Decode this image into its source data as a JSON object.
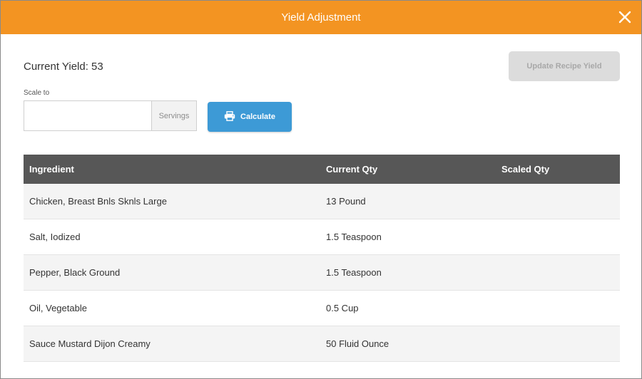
{
  "dialog": {
    "title": "Yield Adjustment",
    "close_icon": "close-icon",
    "header_color": "#f39422"
  },
  "current_yield_label": "Current Yield: 53",
  "update_button_label": "Update Recipe Yield",
  "scale": {
    "label": "Scale to",
    "value": "",
    "placeholder": "",
    "addon": "Servings"
  },
  "calculate_button": {
    "label": "Calculate",
    "icon": "printer-icon",
    "color": "#3d9ad6"
  },
  "table": {
    "headers": [
      "Ingredient",
      "Current Qty",
      "Scaled Qty"
    ],
    "rows": [
      {
        "ingredient": "Chicken, Breast Bnls Sknls Large",
        "current_qty": "13 Pound",
        "scaled_qty": ""
      },
      {
        "ingredient": "Salt, Iodized",
        "current_qty": "1.5 Teaspoon",
        "scaled_qty": ""
      },
      {
        "ingredient": "Pepper, Black Ground",
        "current_qty": "1.5 Teaspoon",
        "scaled_qty": ""
      },
      {
        "ingredient": "Oil, Vegetable",
        "current_qty": "0.5 Cup",
        "scaled_qty": ""
      },
      {
        "ingredient": "Sauce Mustard Dijon Creamy",
        "current_qty": "50 Fluid Ounce",
        "scaled_qty": ""
      }
    ]
  }
}
